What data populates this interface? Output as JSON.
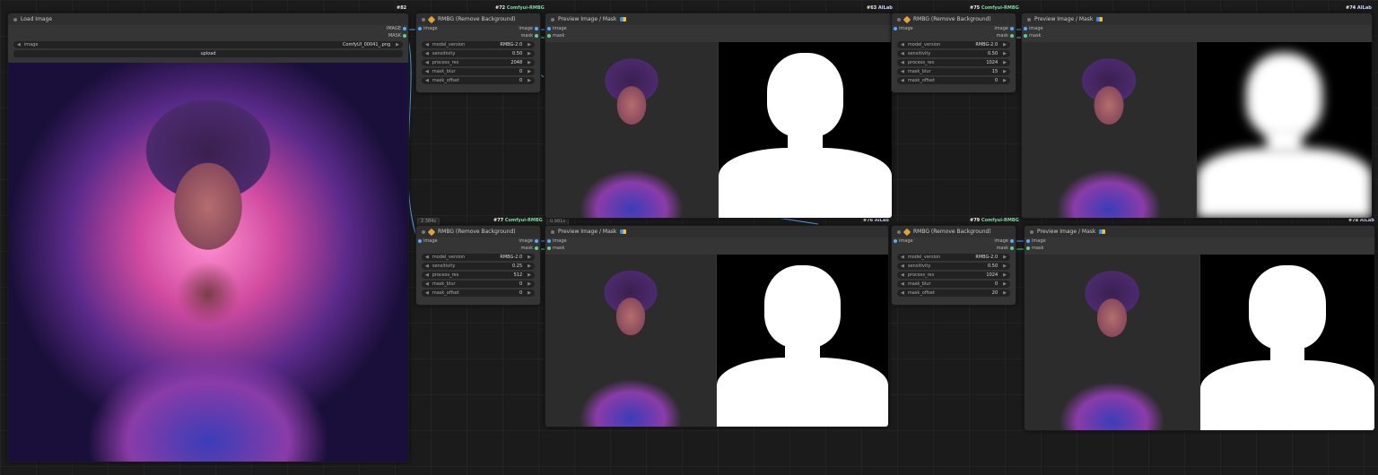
{
  "nodes": {
    "load_image": {
      "title": "Load Image",
      "id": "#82",
      "out1": "IMAGE",
      "out2": "MASK",
      "image_label": "image",
      "image_value": "ComfyUI_00041_.png",
      "upload_label": "upload"
    },
    "rmbg_72": {
      "title": "RMBG (Remove Background)",
      "id": "#72",
      "src": "Comfyui-RMBG",
      "in": "image",
      "out1": "image",
      "out2": "mask",
      "w": [
        [
          "model_version",
          "RMBG-2.0"
        ],
        [
          "sensitivity",
          "0.50"
        ],
        [
          "process_res",
          "2048"
        ],
        [
          "mask_blur",
          "0"
        ],
        [
          "mask_offset",
          "0"
        ]
      ]
    },
    "preview_63": {
      "title": "Preview Image / Mask",
      "id": "#63",
      "src": "AILab",
      "in1": "image",
      "in2": "mask"
    },
    "rmbg_75": {
      "title": "RMBG (Remove Background)",
      "id": "#75",
      "src": "Comfyui-RMBG",
      "in": "image",
      "out1": "image",
      "out2": "mask",
      "w": [
        [
          "model_version",
          "RMBG-2.0"
        ],
        [
          "sensitivity",
          "0.50"
        ],
        [
          "process_res",
          "1024"
        ],
        [
          "mask_blur",
          "15"
        ],
        [
          "mask_offset",
          "0"
        ]
      ]
    },
    "preview_74": {
      "title": "Preview Image / Mask",
      "id": "#74",
      "src": "AILab",
      "in1": "image",
      "in2": "mask"
    },
    "rmbg_77": {
      "title": "RMBG (Remove Background)",
      "id": "#77",
      "src": "Comfyui-RMBG",
      "time": "2.384s",
      "in": "image",
      "out1": "image",
      "out2": "mask",
      "w": [
        [
          "model_version",
          "RMBG-2.0"
        ],
        [
          "sensitivity",
          "0.25"
        ],
        [
          "process_res",
          "512"
        ],
        [
          "mask_blur",
          "0"
        ],
        [
          "mask_offset",
          "0"
        ]
      ]
    },
    "preview_76": {
      "title": "Preview Image / Mask",
      "id": "#76",
      "src": "AILab",
      "time": "0.981s",
      "in1": "image",
      "in2": "mask"
    },
    "rmbg_79": {
      "title": "RMBG (Remove Background)",
      "id": "#79",
      "src": "Comfyui-RMBG",
      "in": "image",
      "out1": "image",
      "out2": "mask",
      "w": [
        [
          "model_version",
          "RMBG-2.0"
        ],
        [
          "sensitivity",
          "0.50"
        ],
        [
          "process_res",
          "1024"
        ],
        [
          "mask_blur",
          "0"
        ],
        [
          "mask_offset",
          "20"
        ]
      ]
    },
    "preview_78": {
      "title": "Preview Image / Mask",
      "id": "#78",
      "src": "AILab",
      "in1": "image",
      "in2": "mask"
    }
  },
  "colors": {
    "image_port": "#57a8ff",
    "mask_port": "#5fd08a",
    "node_bg": "#353535",
    "canvas_bg": "#1b1b1b"
  }
}
